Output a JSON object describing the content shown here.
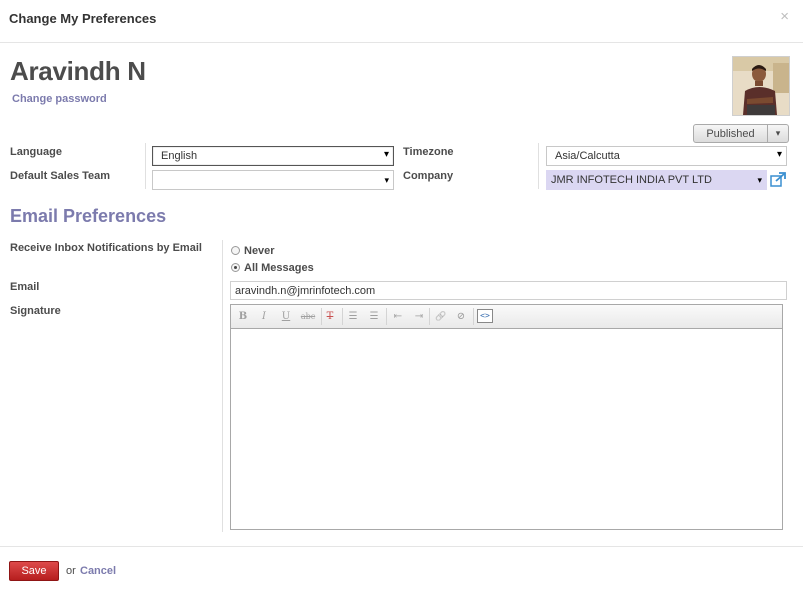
{
  "dialog": {
    "title": "Change My Preferences",
    "close_glyph": "×"
  },
  "profile": {
    "name": "Aravindh N",
    "change_password": "Change password",
    "status_button": "Published",
    "status_caret": "▾"
  },
  "form": {
    "language_label": "Language",
    "language_value": "English",
    "default_sales_team_label": "Default Sales Team",
    "default_sales_team_value": "",
    "timezone_label": "Timezone",
    "timezone_value": "Asia/Calcutta",
    "company_label": "Company",
    "company_value": "JMR INFOTECH INDIA PVT LTD",
    "select_caret": "▾"
  },
  "email_prefs": {
    "section_title": "Email Preferences",
    "notifications_label": "Receive Inbox Notifications by Email",
    "options": [
      {
        "label": "Never",
        "checked": false
      },
      {
        "label": "All Messages",
        "checked": true
      }
    ],
    "email_label": "Email",
    "email_value": "aravindh.n@jmrinfotech.com",
    "signature_label": "Signature",
    "signature_value": ""
  },
  "editor_toolbar": {
    "bold": "B",
    "italic": "I",
    "underline": "U",
    "strike": "abc",
    "remove_format": "T",
    "bullets": "☰",
    "numbers": "☰",
    "outdent": "⇤",
    "indent": "⇥",
    "link": "🔗",
    "unlink": "⊘",
    "source": "<>"
  },
  "footer": {
    "save": "Save",
    "or": "or",
    "cancel": "Cancel"
  },
  "colors": {
    "accent": "#7c7bad",
    "save": "#c42b2b",
    "company_bg": "#dbd7f2"
  }
}
